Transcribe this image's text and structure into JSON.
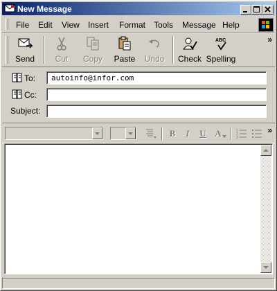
{
  "window": {
    "title": "New Message"
  },
  "menu": [
    "File",
    "Edit",
    "View",
    "Insert",
    "Format",
    "Tools",
    "Message",
    "Help"
  ],
  "toolbar": {
    "send": "Send",
    "cut": "Cut",
    "copy": "Copy",
    "paste": "Paste",
    "undo": "Undo",
    "check": "Check",
    "spelling": "Spelling",
    "more": "»"
  },
  "headers": {
    "to_label": "To:",
    "to_value": "autoinfo@infor.com",
    "cc_label": "Cc:",
    "cc_value": "",
    "subject_label": "Subject:",
    "subject_value": ""
  },
  "format": {
    "bold": "B",
    "italic": "I",
    "underline": "U",
    "font_color": "A",
    "more": "»"
  },
  "message_body": ""
}
